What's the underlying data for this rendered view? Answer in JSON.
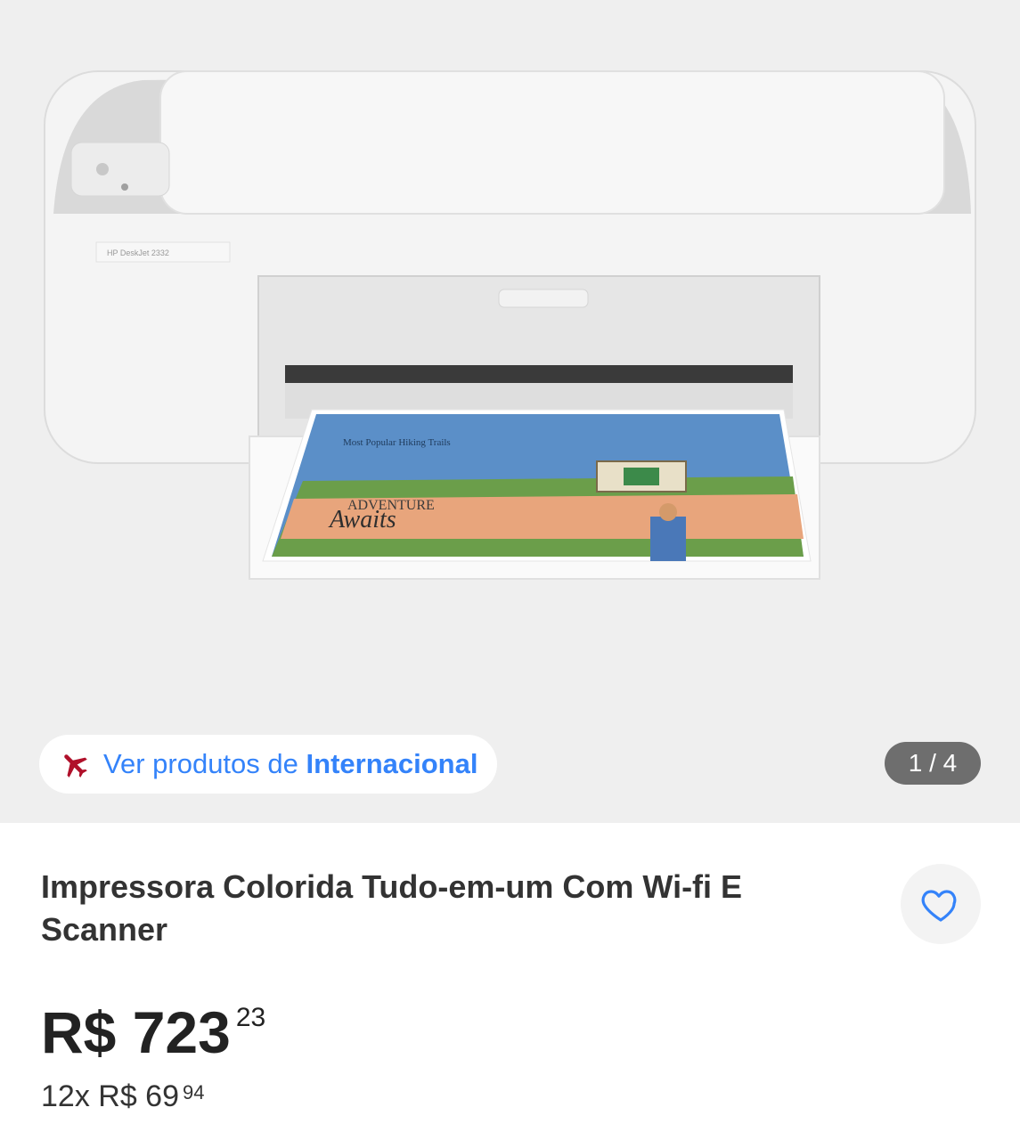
{
  "gallery": {
    "image_alt": "Impressora HP DeskJet 2332",
    "printer_label": "HP DeskJet 2332",
    "print_text_top": "Most Popular Hiking Trails",
    "print_text_mid": "ADVENTURE",
    "print_text_script": "Awaits",
    "pager": "1 / 4"
  },
  "store_chip": {
    "prefix": "Ver produtos de",
    "store": "Internacional",
    "icon": "airplane-icon"
  },
  "product": {
    "title": "Impressora Colorida Tudo-em-um Com Wi-fi E Scanner",
    "price_main": "R$ 723",
    "price_cents": "23",
    "installments_main": "12x R$ 69",
    "installments_cents": "94"
  },
  "colors": {
    "accent_blue": "#3483fa",
    "plane_red": "#b0102a",
    "pager_bg": "#6e6e6e"
  }
}
